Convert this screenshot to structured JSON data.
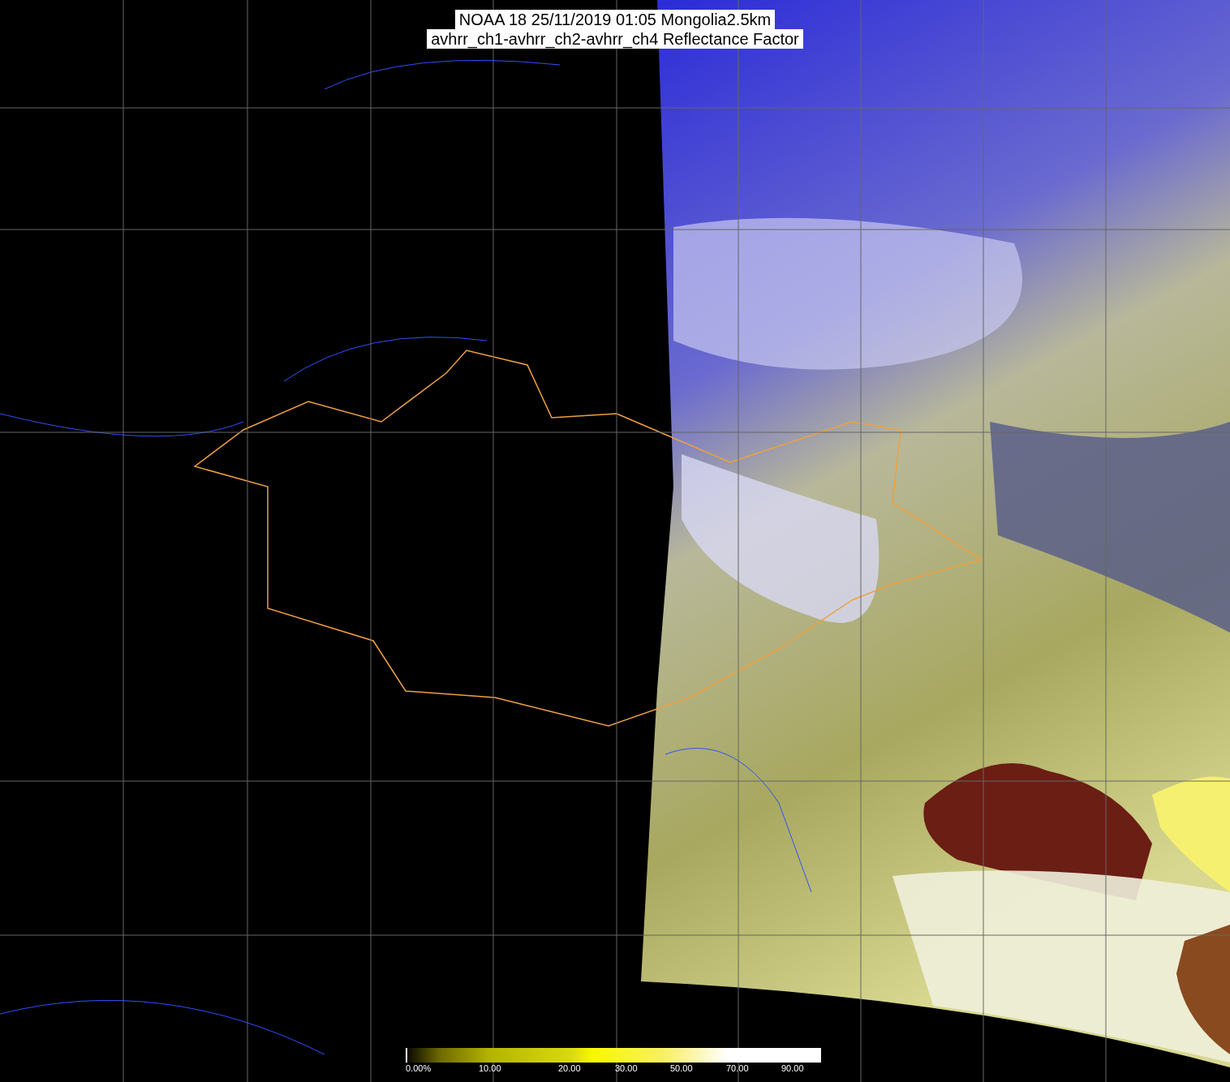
{
  "title": {
    "line_1": "NOAA 18 25/11/2019 01:05 Mongolia2.5km",
    "line_2": "avhrr_ch1-avhrr_ch2-avhrr_ch4 Reflectance Factor"
  },
  "legend": {
    "labels": [
      "0.00%",
      "10.00",
      "20.00",
      "30.00",
      "50.00",
      "70.00",
      "90.00"
    ]
  }
}
